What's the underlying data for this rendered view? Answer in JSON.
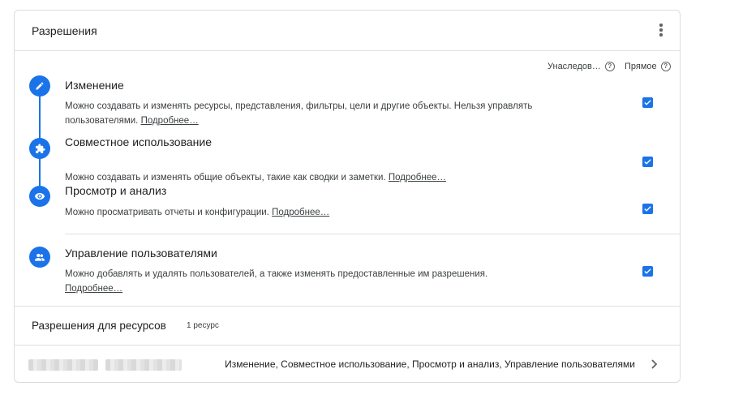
{
  "panel": {
    "title": "Разрешения",
    "more_icon": "more-vert-icon"
  },
  "columns": {
    "inherited": "Унаследов…",
    "direct": "Прямое",
    "help_icon": "help-circle-icon"
  },
  "roles": [
    {
      "icon": "pencil-icon",
      "title": "Изменение",
      "description": "Можно создавать и изменять ресурсы, представления, фильтры, цели и другие объекты. Нельзя управлять пользователями.",
      "link": "Подробнее…",
      "direct_checked": true
    },
    {
      "icon": "puzzle-icon",
      "title": "Совместное использование",
      "description": "Можно создавать и изменять общие объекты, такие как сводки и заметки.",
      "link": "Подробнее…",
      "direct_checked": true
    },
    {
      "icon": "eye-icon",
      "title": "Просмотр и анализ",
      "description": "Можно просматривать отчеты и конфигурации.",
      "link": "Подробнее…",
      "direct_checked": true
    },
    {
      "icon": "people-icon",
      "title": "Управление пользователями",
      "description": "Можно добавлять и удалять пользователей, а также изменять предоставленные им разрешения.",
      "link": "Подробнее…",
      "direct_checked": true
    }
  ],
  "resources": {
    "title": "Разрешения для ресурсов",
    "count": "1 ресурс",
    "rows": [
      {
        "permissions": "Изменение, Совместное использование, Просмотр и анализ, Управление пользователями",
        "chevron_icon": "chevron-right-icon"
      }
    ]
  },
  "colors": {
    "accent": "#1a73e8",
    "border": "#dadce0",
    "text": "#202124",
    "secondary_text": "#3c4043"
  }
}
